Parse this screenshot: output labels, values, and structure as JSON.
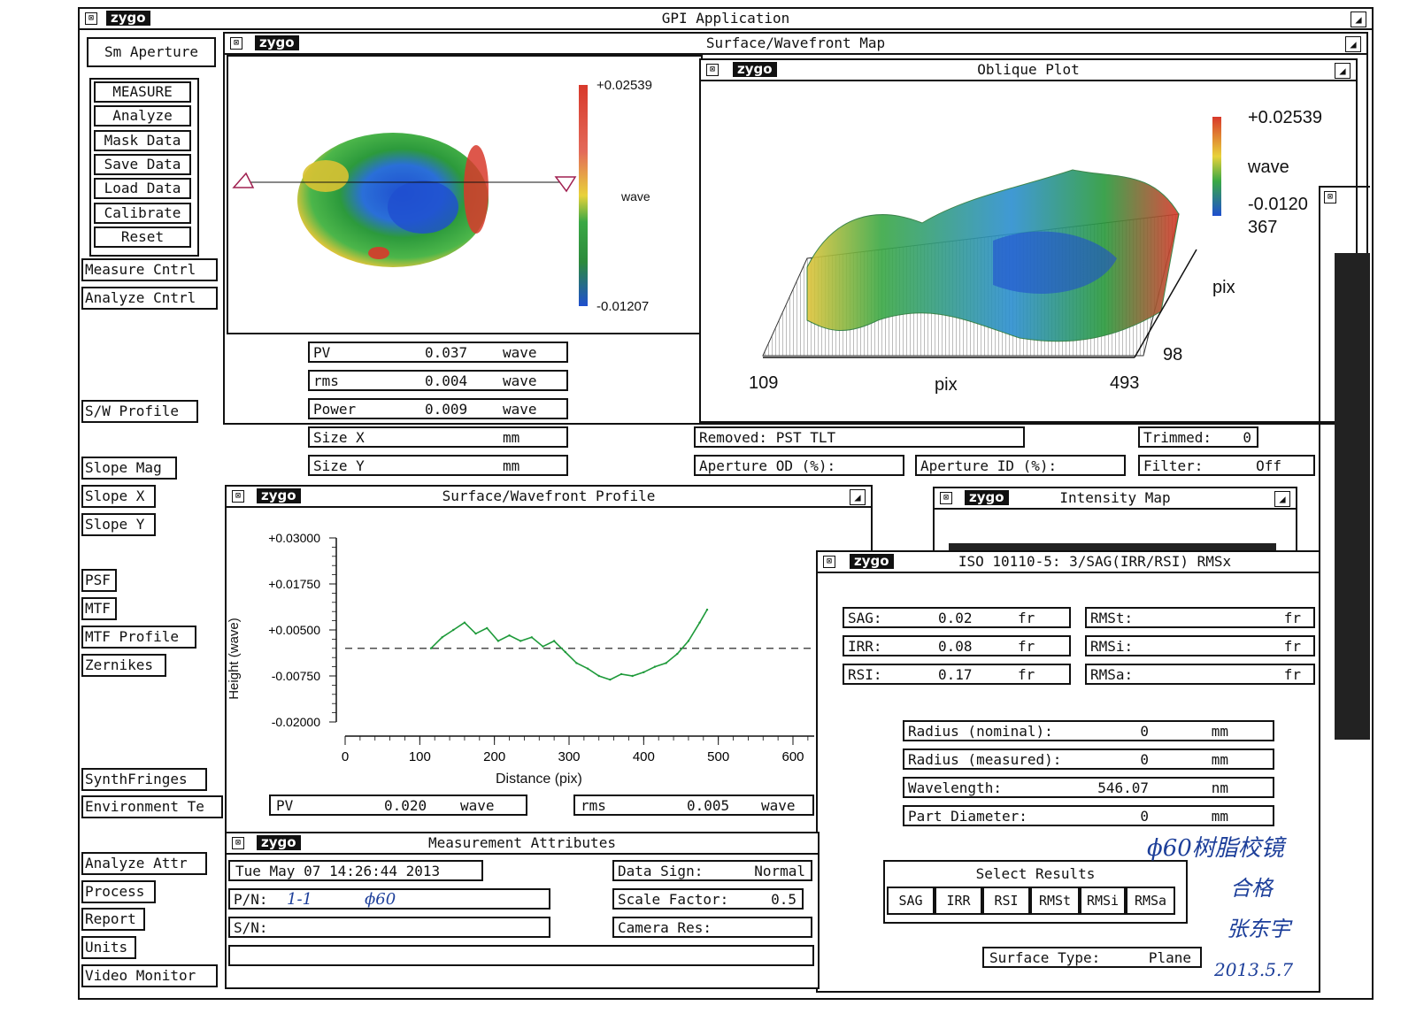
{
  "app": {
    "logo": "zygo",
    "title": "GPI Application"
  },
  "sidebar": {
    "aperture": "Sm Aperture",
    "main_buttons": [
      "MEASURE",
      "Analyze",
      "Mask Data",
      "Save Data",
      "Load Data",
      "Calibrate",
      "Reset"
    ],
    "measure_cntrl": "Measure Cntrl",
    "analyze_cntrl": "Analyze Cntrl",
    "sw_profile": "S/W Profile",
    "slope_mag": "Slope Mag",
    "slope_x": "Slope X",
    "slope_y": "Slope Y",
    "psf": "PSF",
    "mtf": "MTF",
    "mtf_profile": "MTF Profile",
    "zernikes": "Zernikes",
    "synth": "SynthFringes",
    "environment": "Environment Te",
    "analyze_attr": "Analyze Attr",
    "process": "Process",
    "report": "Report",
    "units": "Units",
    "video": "Video Monitor"
  },
  "surface_map": {
    "title": "Surface/Wavefront Map",
    "scale_max": "+0.02539",
    "scale_min": "-0.01207",
    "scale_unit": "wave",
    "results": [
      {
        "label": "PV",
        "value": "0.037",
        "unit": "wave"
      },
      {
        "label": "rms",
        "value": "0.004",
        "unit": "wave"
      },
      {
        "label": "Power",
        "value": "0.009",
        "unit": "wave"
      },
      {
        "label": "Size X",
        "value": "",
        "unit": "mm"
      },
      {
        "label": "Size Y",
        "value": "",
        "unit": "mm"
      }
    ]
  },
  "oblique": {
    "title": "Oblique Plot",
    "scale_max": "+0.02539",
    "scale_unit": "wave",
    "scale_min": "-0.0120",
    "ypix_max": "367",
    "axis_pix_right": "pix",
    "ypix_min": "98",
    "x_min": "109",
    "x_label": "pix",
    "x_max": "493"
  },
  "status_fields": {
    "removed": "Removed: PST TLT",
    "trimmed_label": "Trimmed:",
    "trimmed_value": "0",
    "aperture_od": "Aperture OD (%):",
    "aperture_id": "Aperture ID (%):",
    "filter_label": "Filter:",
    "filter_value": "Off"
  },
  "profile": {
    "title": "Surface/Wavefront Profile",
    "pv_label": "PV",
    "pv_value": "0.020",
    "pv_unit": "wave",
    "rms_label": "rms",
    "rms_value": "0.005",
    "rms_unit": "wave"
  },
  "chart_data": {
    "type": "line",
    "xlabel": "Distance (pix)",
    "ylabel": "Height (wave)",
    "xlim": [
      0,
      600
    ],
    "ylim": [
      -0.02,
      0.03
    ],
    "x_ticks": [
      "0",
      "100",
      "200",
      "300",
      "400",
      "500",
      "600"
    ],
    "y_ticks": [
      "+0.03000",
      "+0.01750",
      "+0.00500",
      "-0.00750",
      "-0.02000"
    ],
    "series": [
      {
        "x": [
          115,
          130,
          145,
          160,
          175,
          190,
          205,
          220,
          235,
          250,
          265,
          280,
          295,
          310,
          325,
          340,
          355,
          370,
          385,
          400,
          415,
          430,
          445,
          460,
          475,
          485
        ],
        "values": [
          0.0,
          0.003,
          0.005,
          0.007,
          0.004,
          0.0055,
          0.002,
          0.0035,
          0.002,
          0.003,
          0.0005,
          0.002,
          -0.001,
          -0.004,
          -0.0055,
          -0.0075,
          -0.0085,
          -0.007,
          -0.0075,
          -0.0065,
          -0.005,
          -0.004,
          -0.0015,
          0.002,
          0.007,
          0.0105
        ]
      }
    ]
  },
  "intensity": {
    "title": "Intensity Map"
  },
  "iso": {
    "title": "ISO 10110-5: 3/SAG(IRR/RSI) RMSx",
    "left_rows": [
      {
        "label": "SAG:",
        "value": "0.02",
        "unit": "fr"
      },
      {
        "label": "IRR:",
        "value": "0.08",
        "unit": "fr"
      },
      {
        "label": "RSI:",
        "value": "0.17",
        "unit": "fr"
      }
    ],
    "right_rows": [
      {
        "label": "RMSt:",
        "unit": "fr"
      },
      {
        "label": "RMSi:",
        "unit": "fr"
      },
      {
        "label": "RMSa:",
        "unit": "fr"
      }
    ],
    "params": [
      {
        "label": "Radius  (nominal):",
        "value": "0",
        "unit": "mm"
      },
      {
        "label": "Radius (measured):",
        "value": "0",
        "unit": "mm"
      },
      {
        "label": "Wavelength:",
        "value": "546.07",
        "unit": "nm"
      },
      {
        "label": "Part Diameter:",
        "value": "0",
        "unit": "mm"
      }
    ],
    "select_title": "Select Results",
    "select_buttons": [
      "SAG",
      "IRR",
      "RSI",
      "RMSt",
      "RMSi",
      "RMSa"
    ],
    "surface_type_label": "Surface Type:",
    "surface_type_value": "Plane"
  },
  "attributes": {
    "title": "Measurement Attributes",
    "date": "Tue May 07 14:26:44 2013",
    "pn_label": "P/N:",
    "pn_hand": "1-1",
    "pn_hand2": "ϕ60",
    "sn_label": "S/N:",
    "data_sign_label": "Data Sign:",
    "data_sign_value": "Normal",
    "scale_label": "Scale Factor:",
    "scale_value": "0.5",
    "camera_label": "Camera Res:"
  },
  "handwriting": {
    "line1": "ϕ60树脂校镜",
    "line2": "合格",
    "line3": "张东宇",
    "date": "2013.5.7"
  },
  "colors": {
    "frame": "#111111",
    "profile_line": "#1e9a3a",
    "hand_ink": "#1d3f9a"
  }
}
